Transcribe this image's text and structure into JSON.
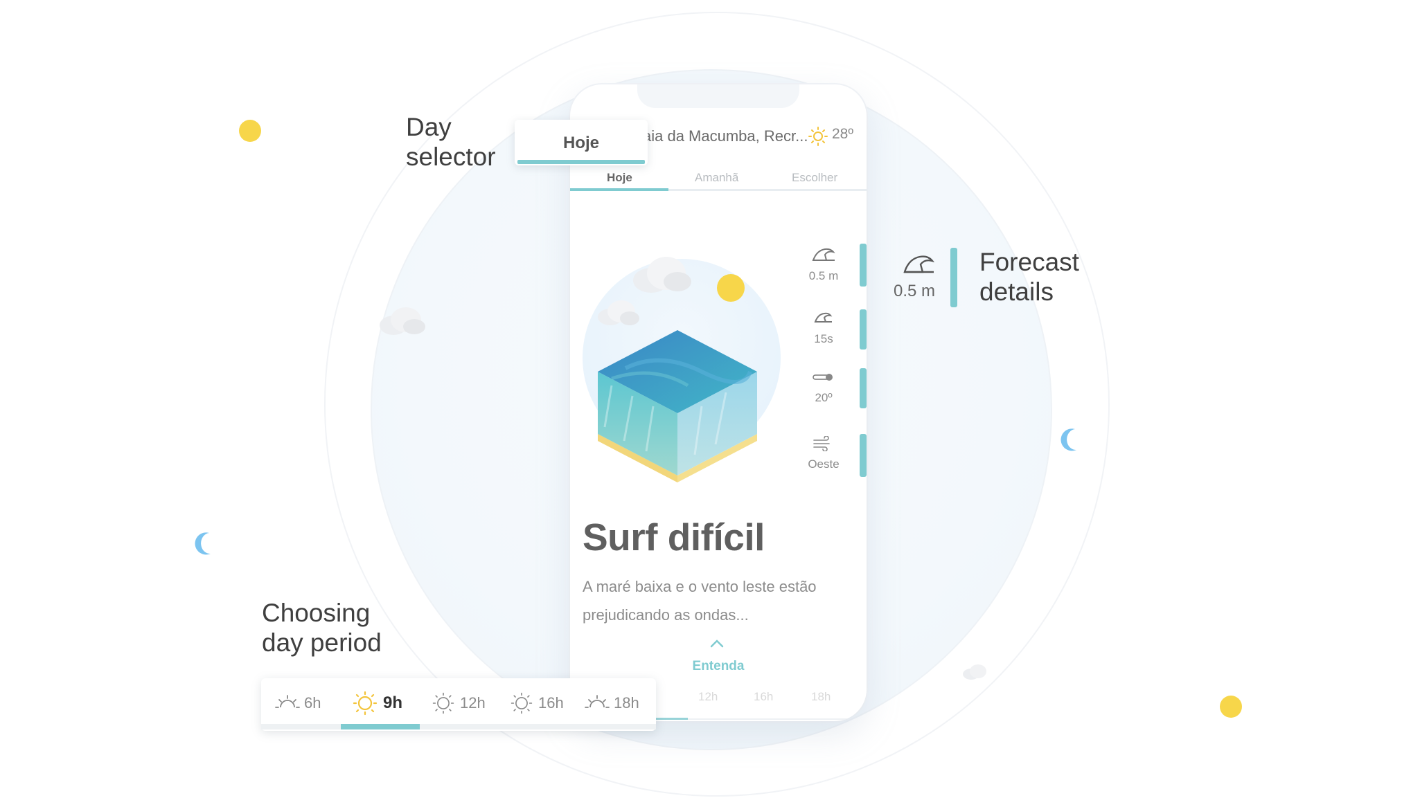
{
  "callouts": {
    "day_selector": [
      "Day",
      "selector"
    ],
    "forecast_details": [
      "Forecast",
      "details"
    ],
    "choosing_period": [
      "Choosing",
      "day period"
    ]
  },
  "day_card": {
    "label": "Hoje"
  },
  "forecast_detail": {
    "icon": "wave-icon",
    "value": "0.5 m"
  },
  "phone": {
    "location": "aia da Macumba, Recr...",
    "temperature": "28º",
    "tabs": [
      "Hoje",
      "Amanhã",
      "Escolher"
    ],
    "active_tab": "Hoje",
    "metrics": [
      {
        "icon": "wave-height-icon",
        "value": "0.5 m"
      },
      {
        "icon": "wave-period-icon",
        "value": "15s"
      },
      {
        "icon": "thermometer-icon",
        "value": "20º"
      },
      {
        "icon": "wind-icon",
        "value": "Oeste"
      }
    ],
    "headline": "Surf difícil",
    "description": "A maré baixa e o vento leste estão prejudicando as ondas...",
    "entenda": "Entenda",
    "periods": [
      "9h",
      "12h",
      "16h",
      "18h"
    ]
  },
  "period_selector": {
    "items": [
      {
        "label": "6h",
        "icon": "sunrise-icon"
      },
      {
        "label": "9h",
        "icon": "sun-icon",
        "active": true
      },
      {
        "label": "12h",
        "icon": "sun-outline-icon"
      },
      {
        "label": "16h",
        "icon": "sun-outline-icon"
      },
      {
        "label": "18h",
        "icon": "sunset-icon"
      }
    ]
  },
  "colors": {
    "accent": "#7fcbd0",
    "sun": "#f7d64a",
    "moon": "#7cc4f0",
    "text_dark": "#3f3f3f"
  }
}
